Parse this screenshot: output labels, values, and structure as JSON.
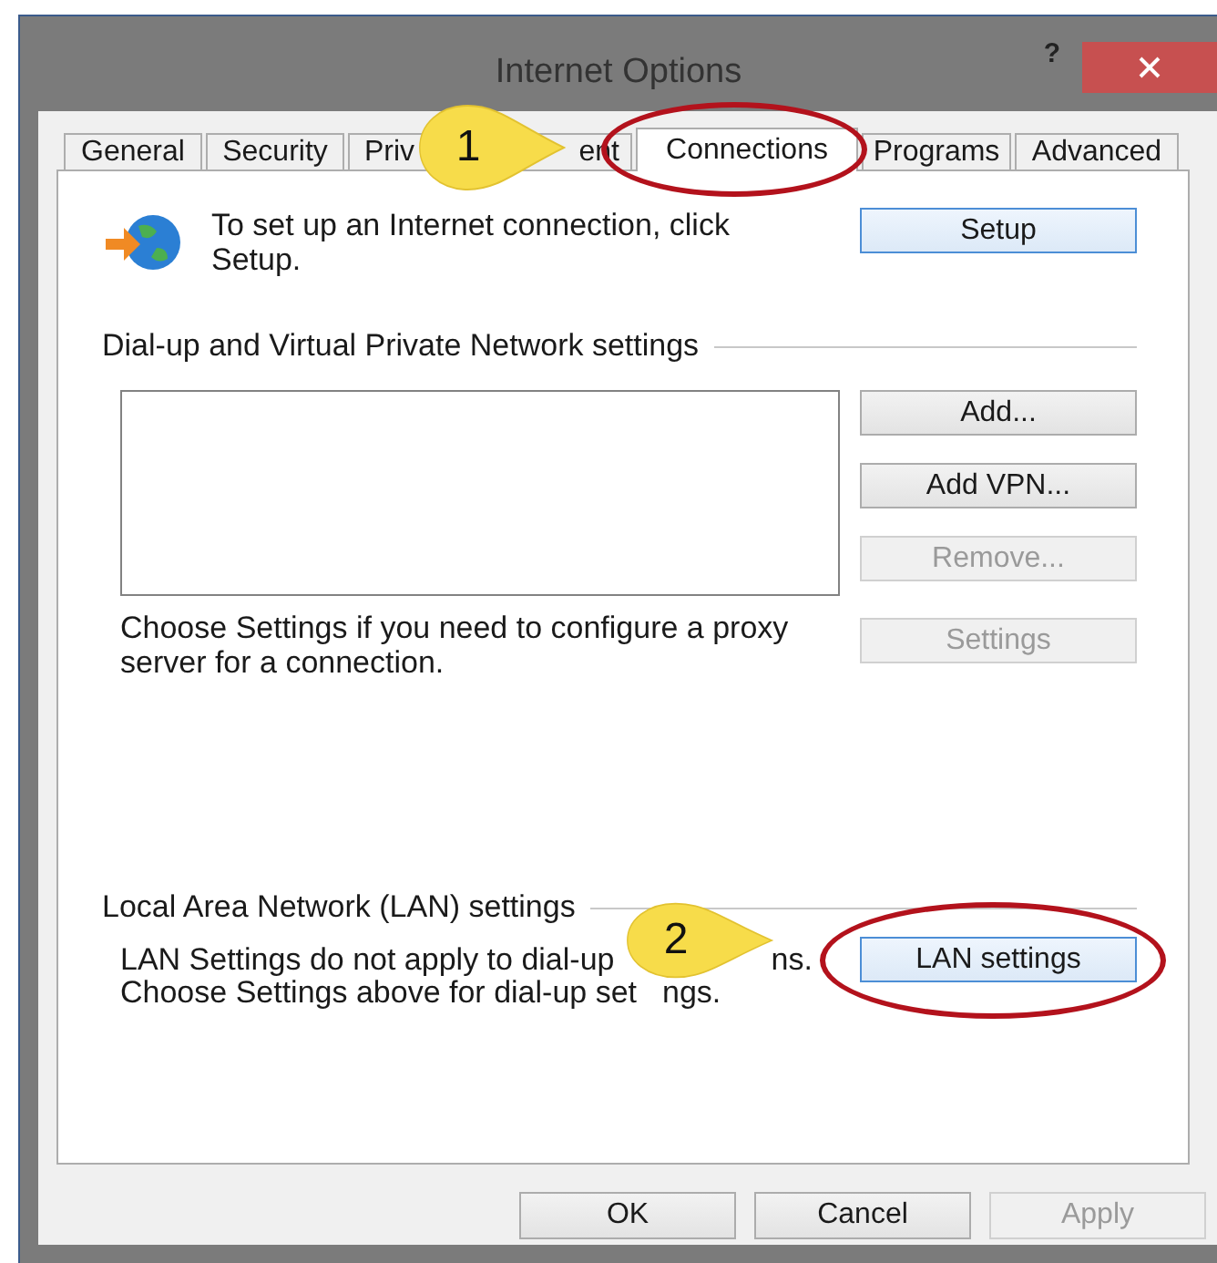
{
  "window": {
    "title": "Internet Options",
    "help": "?"
  },
  "tabs": [
    {
      "label": "General",
      "selected": false
    },
    {
      "label": "Security",
      "selected": false
    },
    {
      "label": "Priv",
      "selected": false
    },
    {
      "label": "ent",
      "selected": false
    },
    {
      "label": "Connections",
      "selected": true
    },
    {
      "label": "Programs",
      "selected": false
    },
    {
      "label": "Advanced",
      "selected": false
    }
  ],
  "setup": {
    "text": "To set up an Internet connection, click Setup.",
    "button": {
      "label": "Setup",
      "disabled": false
    }
  },
  "vpn_section": {
    "heading": "Dial-up and Virtual Private Network settings",
    "buttons": [
      {
        "label": "Add...",
        "disabled": false
      },
      {
        "label": "Add VPN...",
        "disabled": false
      },
      {
        "label": "Remove...",
        "disabled": true
      },
      {
        "label": "Settings",
        "disabled": true
      }
    ],
    "note": "Choose Settings if you need to configure a proxy server for a connection."
  },
  "lan_section": {
    "heading": "Local Area Network (LAN) settings",
    "note_lines": [
      [
        "LAN Settings do not apply to dial-up",
        "ns."
      ],
      [
        "Choose Settings above for dial-up set",
        "ngs."
      ]
    ],
    "button": {
      "label": "LAN settings",
      "disabled": false
    }
  },
  "footer_buttons": [
    {
      "label": "OK",
      "disabled": false
    },
    {
      "label": "Cancel",
      "disabled": false
    },
    {
      "label": "Apply",
      "disabled": true
    }
  ],
  "callouts": [
    {
      "label": "1"
    },
    {
      "label": "2"
    }
  ]
}
